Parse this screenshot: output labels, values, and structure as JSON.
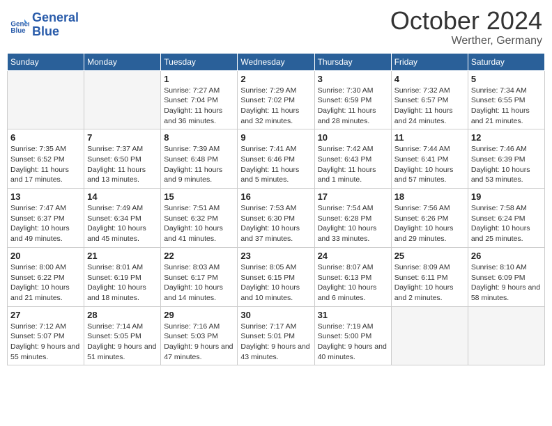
{
  "header": {
    "logo_line1": "General",
    "logo_line2": "Blue",
    "month_title": "October 2024",
    "location": "Werther, Germany"
  },
  "days_of_week": [
    "Sunday",
    "Monday",
    "Tuesday",
    "Wednesday",
    "Thursday",
    "Friday",
    "Saturday"
  ],
  "weeks": [
    [
      {
        "day": "",
        "content": ""
      },
      {
        "day": "",
        "content": ""
      },
      {
        "day": "1",
        "content": "Sunrise: 7:27 AM\nSunset: 7:04 PM\nDaylight: 11 hours and 36 minutes."
      },
      {
        "day": "2",
        "content": "Sunrise: 7:29 AM\nSunset: 7:02 PM\nDaylight: 11 hours and 32 minutes."
      },
      {
        "day": "3",
        "content": "Sunrise: 7:30 AM\nSunset: 6:59 PM\nDaylight: 11 hours and 28 minutes."
      },
      {
        "day": "4",
        "content": "Sunrise: 7:32 AM\nSunset: 6:57 PM\nDaylight: 11 hours and 24 minutes."
      },
      {
        "day": "5",
        "content": "Sunrise: 7:34 AM\nSunset: 6:55 PM\nDaylight: 11 hours and 21 minutes."
      }
    ],
    [
      {
        "day": "6",
        "content": "Sunrise: 7:35 AM\nSunset: 6:52 PM\nDaylight: 11 hours and 17 minutes."
      },
      {
        "day": "7",
        "content": "Sunrise: 7:37 AM\nSunset: 6:50 PM\nDaylight: 11 hours and 13 minutes."
      },
      {
        "day": "8",
        "content": "Sunrise: 7:39 AM\nSunset: 6:48 PM\nDaylight: 11 hours and 9 minutes."
      },
      {
        "day": "9",
        "content": "Sunrise: 7:41 AM\nSunset: 6:46 PM\nDaylight: 11 hours and 5 minutes."
      },
      {
        "day": "10",
        "content": "Sunrise: 7:42 AM\nSunset: 6:43 PM\nDaylight: 11 hours and 1 minute."
      },
      {
        "day": "11",
        "content": "Sunrise: 7:44 AM\nSunset: 6:41 PM\nDaylight: 10 hours and 57 minutes."
      },
      {
        "day": "12",
        "content": "Sunrise: 7:46 AM\nSunset: 6:39 PM\nDaylight: 10 hours and 53 minutes."
      }
    ],
    [
      {
        "day": "13",
        "content": "Sunrise: 7:47 AM\nSunset: 6:37 PM\nDaylight: 10 hours and 49 minutes."
      },
      {
        "day": "14",
        "content": "Sunrise: 7:49 AM\nSunset: 6:34 PM\nDaylight: 10 hours and 45 minutes."
      },
      {
        "day": "15",
        "content": "Sunrise: 7:51 AM\nSunset: 6:32 PM\nDaylight: 10 hours and 41 minutes."
      },
      {
        "day": "16",
        "content": "Sunrise: 7:53 AM\nSunset: 6:30 PM\nDaylight: 10 hours and 37 minutes."
      },
      {
        "day": "17",
        "content": "Sunrise: 7:54 AM\nSunset: 6:28 PM\nDaylight: 10 hours and 33 minutes."
      },
      {
        "day": "18",
        "content": "Sunrise: 7:56 AM\nSunset: 6:26 PM\nDaylight: 10 hours and 29 minutes."
      },
      {
        "day": "19",
        "content": "Sunrise: 7:58 AM\nSunset: 6:24 PM\nDaylight: 10 hours and 25 minutes."
      }
    ],
    [
      {
        "day": "20",
        "content": "Sunrise: 8:00 AM\nSunset: 6:22 PM\nDaylight: 10 hours and 21 minutes."
      },
      {
        "day": "21",
        "content": "Sunrise: 8:01 AM\nSunset: 6:19 PM\nDaylight: 10 hours and 18 minutes."
      },
      {
        "day": "22",
        "content": "Sunrise: 8:03 AM\nSunset: 6:17 PM\nDaylight: 10 hours and 14 minutes."
      },
      {
        "day": "23",
        "content": "Sunrise: 8:05 AM\nSunset: 6:15 PM\nDaylight: 10 hours and 10 minutes."
      },
      {
        "day": "24",
        "content": "Sunrise: 8:07 AM\nSunset: 6:13 PM\nDaylight: 10 hours and 6 minutes."
      },
      {
        "day": "25",
        "content": "Sunrise: 8:09 AM\nSunset: 6:11 PM\nDaylight: 10 hours and 2 minutes."
      },
      {
        "day": "26",
        "content": "Sunrise: 8:10 AM\nSunset: 6:09 PM\nDaylight: 9 hours and 58 minutes."
      }
    ],
    [
      {
        "day": "27",
        "content": "Sunrise: 7:12 AM\nSunset: 5:07 PM\nDaylight: 9 hours and 55 minutes."
      },
      {
        "day": "28",
        "content": "Sunrise: 7:14 AM\nSunset: 5:05 PM\nDaylight: 9 hours and 51 minutes."
      },
      {
        "day": "29",
        "content": "Sunrise: 7:16 AM\nSunset: 5:03 PM\nDaylight: 9 hours and 47 minutes."
      },
      {
        "day": "30",
        "content": "Sunrise: 7:17 AM\nSunset: 5:01 PM\nDaylight: 9 hours and 43 minutes."
      },
      {
        "day": "31",
        "content": "Sunrise: 7:19 AM\nSunset: 5:00 PM\nDaylight: 9 hours and 40 minutes."
      },
      {
        "day": "",
        "content": ""
      },
      {
        "day": "",
        "content": ""
      }
    ]
  ]
}
